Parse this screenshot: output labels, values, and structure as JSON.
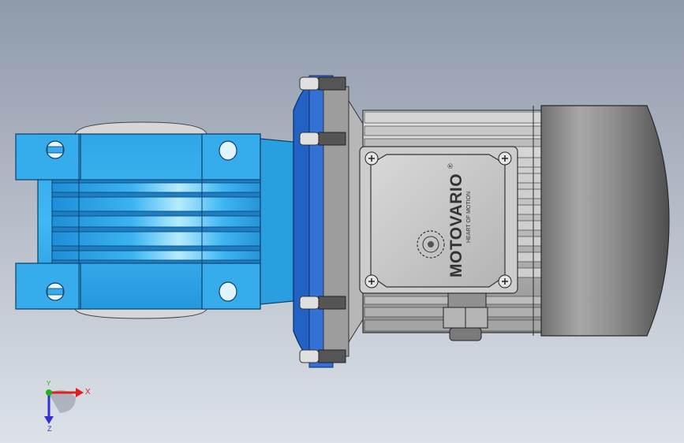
{
  "viewport": {
    "background_top": "#8f9aaa",
    "background_bottom": "#dde2e9"
  },
  "model": {
    "brand": "MOTOVARIO",
    "registered_mark": "®",
    "tagline": "HEART OF MOTION",
    "colors": {
      "gearbox_blue": "#2a9fe0",
      "gearbox_blue_light": "#8fd8ff",
      "gearbox_blue_dark": "#1469a8",
      "flange_blue": "#1f63c2",
      "motor_metal": "#c3c3c3",
      "motor_metal_dark": "#7d7d7d",
      "fan_cover": "#8e8e8e"
    },
    "icons": [
      "bolt-icon",
      "screw-icon",
      "brand-logo-icon",
      "cable-gland-icon"
    ]
  },
  "triad": {
    "x_label": "X",
    "y_label": "Y",
    "z_label": "Z",
    "x_color": "#e02020",
    "y_color": "#22b022",
    "z_color": "#3030d0"
  }
}
